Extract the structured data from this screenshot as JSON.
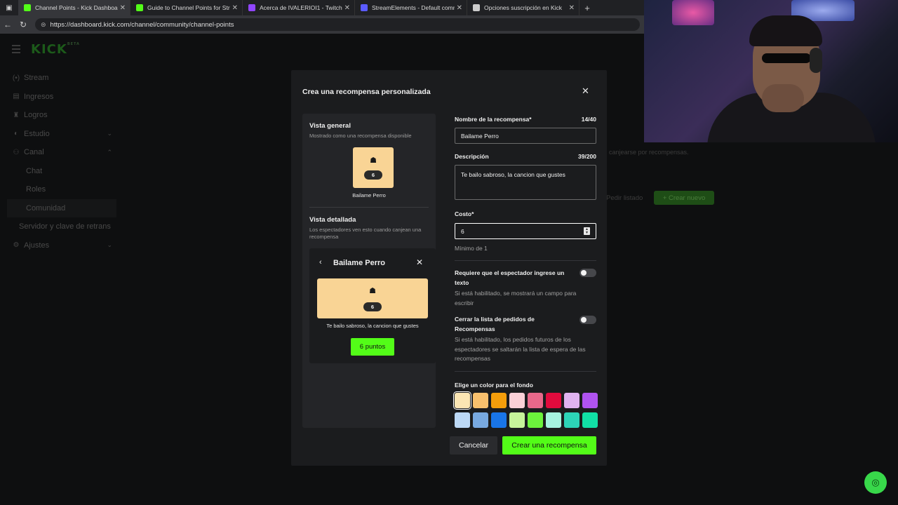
{
  "browser": {
    "tabs": [
      {
        "label": "Channel Points - Kick Dashboard",
        "color": "#53fc18",
        "active": true
      },
      {
        "label": "Guide to Channel Points for Strea",
        "color": "#53fc18",
        "active": false
      },
      {
        "label": "Acerca de IVALERIOI1 - Twitch",
        "color": "#9146ff",
        "active": false
      },
      {
        "label": "StreamElements - Default comma",
        "color": "#5b5bff",
        "active": false
      },
      {
        "label": "Opciones suscripción en Kick",
        "color": "#cccccc",
        "active": false
      }
    ],
    "url": "https://dashboard.kick.com/channel/community/channel-points"
  },
  "logo": {
    "text": "KICK",
    "badge": "BETA"
  },
  "sidebar": {
    "items": [
      {
        "label": "Stream",
        "icon": "broadcast-icon"
      },
      {
        "label": "Ingresos",
        "icon": "money-icon"
      },
      {
        "label": "Logros",
        "icon": "trophy-icon"
      },
      {
        "label": "Estudio",
        "icon": "palette-icon"
      },
      {
        "label": "Canal",
        "icon": "people-icon"
      },
      {
        "label": "Chat"
      },
      {
        "label": "Roles"
      },
      {
        "label": "Comunidad"
      },
      {
        "label": "Servidor y clave de retrans"
      },
      {
        "label": "Ajustes",
        "icon": "gear-icon"
      }
    ]
  },
  "background": {
    "hint_text": "canjearse por recompensas.",
    "pedir_listado": "Pedir listado",
    "crear_nuevo": "+ Crear nuevo"
  },
  "modal": {
    "title": "Crea una recompensa personalizada",
    "preview": {
      "overview_title": "Vista general",
      "overview_sub": "Mostrado como una recompensa disponible",
      "reward_name": "Bailame Perro",
      "cost": "6",
      "detail_title": "Vista detallada",
      "detail_sub": "Los espectadores ven esto cuando canjean una recompensa",
      "description": "Te bailo sabroso, la cancion que gustes",
      "points_button": "6 puntos"
    },
    "form": {
      "name_label": "Nombre de la recompensa*",
      "name_count": "14/40",
      "name_value": "Bailame Perro",
      "desc_label": "Descripción",
      "desc_count": "39/200",
      "desc_value": "Te bailo sabroso, la cancion que gustes",
      "cost_label": "Costo*",
      "cost_value": "6",
      "cost_hint": "Mínimo de 1",
      "require_text_label": "Requiere que el espectador ingrese un texto",
      "require_text_hint": "Si está habilitado, se mostrará un campo para escribir",
      "close_queue_label": "Cerrar la lista de pedidos de Recompensas",
      "close_queue_hint": "Si está habilitado, los pedidos futuros de los espectadores se saltarán la lista de espera de las recompensas",
      "color_label": "Elige un color para el fondo",
      "colors_row1": [
        "#fbe5b3",
        "#f8c06d",
        "#f59e0b",
        "#fbd0d7",
        "#e8688a",
        "#e10b3d",
        "#e0b3f0",
        "#b053f0"
      ],
      "colors_row2": [
        "#bcd8f5",
        "#78a9e0",
        "#1975e8",
        "#c6f39a",
        "#6cf23c",
        "#a6f3e0",
        "#2dd4b8",
        "#11e0a6"
      ],
      "selected_color": "#fbe5b3"
    },
    "cancel": "Cancelar",
    "create": "Crear una recompensa"
  }
}
